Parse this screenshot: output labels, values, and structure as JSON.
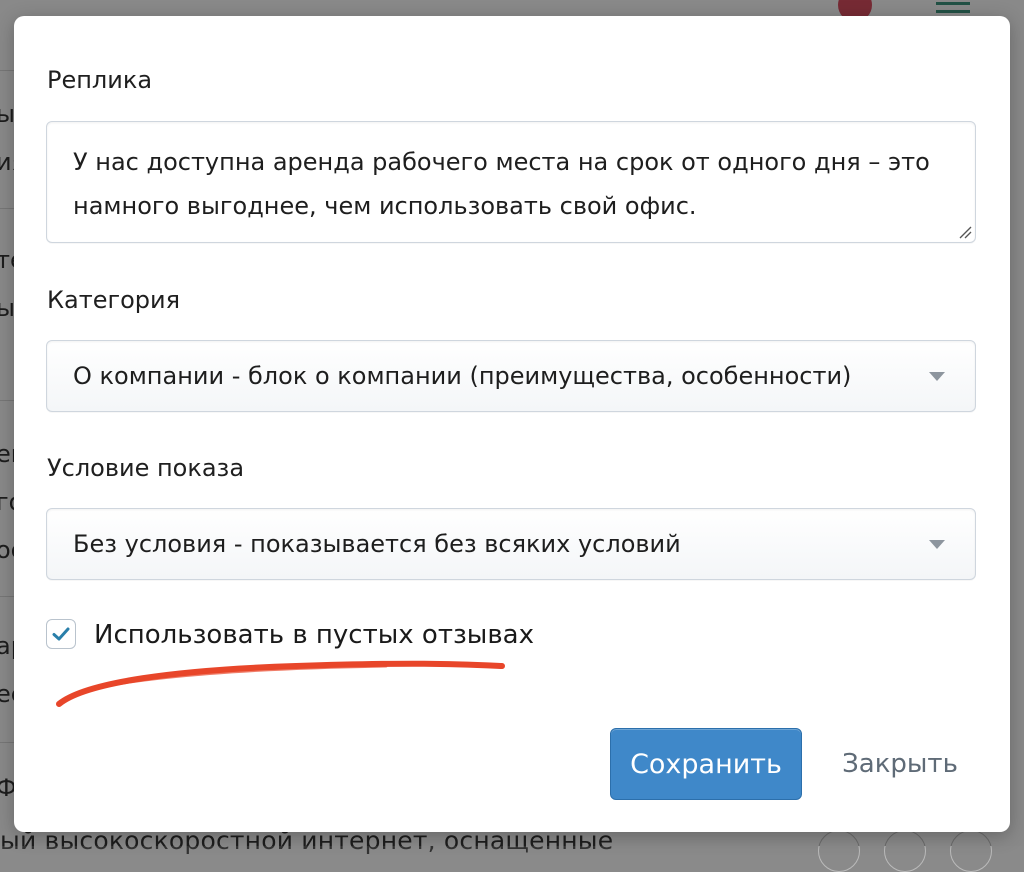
{
  "background": {
    "fragments": [
      "ы",
      "ия",
      "те",
      "ы",
      "ен",
      "го",
      "ос",
      "ар",
      "ее",
      "Ф|"
    ],
    "bottom_text": "ый высокоскоростной интернет, оснащенные"
  },
  "form": {
    "reply": {
      "label": "Реплика",
      "value": "У нас доступна аренда рабочего места на срок от одного дня – это намного выгоднее, чем использовать свой офис."
    },
    "category": {
      "label": "Категория",
      "selected": "О компании - блок о компании (преимущества, особенности)"
    },
    "condition": {
      "label": "Условие показа",
      "selected": "Без условия - показывается без всяких условий"
    },
    "use_in_empty_reviews": {
      "label": "Использовать в пустых отзывах",
      "checked": true
    }
  },
  "actions": {
    "save_label": "Сохранить",
    "close_label": "Закрыть"
  },
  "colors": {
    "primary": "#3f88c9",
    "check": "#2a7faa",
    "annotation": "#e8462a"
  }
}
